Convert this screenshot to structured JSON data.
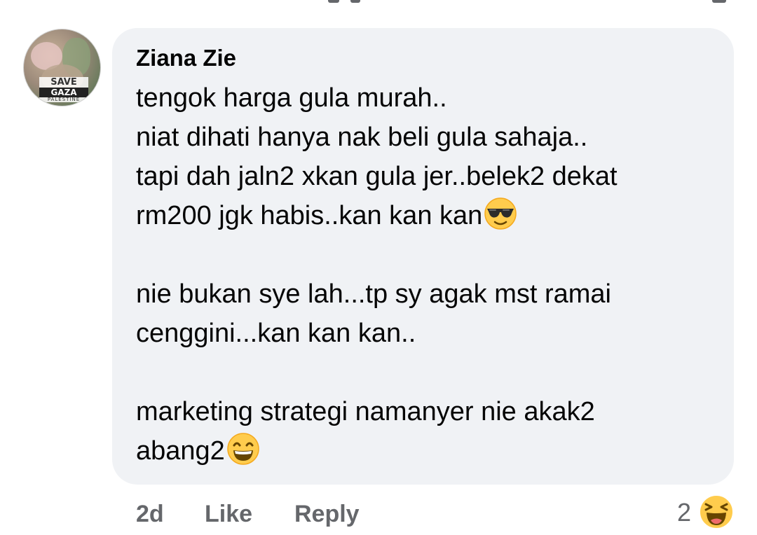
{
  "comment": {
    "author": "Ziana Zie",
    "avatar_badge": [
      "SAVE",
      "GAZA",
      "PALESTINE"
    ],
    "lines": [
      {
        "text": "tengok harga gula murah..",
        "emoji": ""
      },
      {
        "text": "niat dihati hanya nak beli gula sahaja..",
        "emoji": ""
      },
      {
        "text": "tapi dah jaln2 xkan gula jer..belek2 dekat",
        "emoji": ""
      },
      {
        "text": "rm200 jgk habis..kan kan kan",
        "emoji": "sunglasses-emoji"
      },
      {
        "text": "",
        "emoji": ""
      },
      {
        "text": "nie bukan sye lah...tp sy agak mst ramai",
        "emoji": ""
      },
      {
        "text": "cenggini...kan kan kan..",
        "emoji": ""
      },
      {
        "text": "",
        "emoji": ""
      },
      {
        "text": "marketing strategi namanyer nie akak2",
        "emoji": ""
      },
      {
        "text": "abang2",
        "emoji": "grinning-emoji"
      }
    ]
  },
  "actions": {
    "time": "2d",
    "like": "Like",
    "reply": "Reply"
  },
  "reactions": {
    "count": "2",
    "icon": "haha-reaction-icon"
  },
  "colors": {
    "bubble": "#f0f2f5",
    "text": "#050505",
    "meta": "#65676b",
    "emoji_yellow": "#ffcc4d"
  }
}
